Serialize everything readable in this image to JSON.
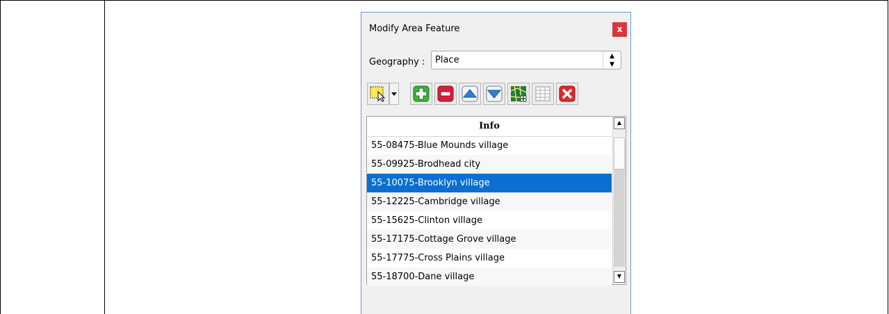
{
  "dialog": {
    "title": "Modify Area Feature",
    "close_label": "x",
    "geography_label": "Geography :",
    "geography_value": "Place"
  },
  "toolbar": {
    "icons": [
      "select-feature-icon",
      "dropdown-arrow-icon",
      "add-icon",
      "remove-icon",
      "move-up-icon",
      "move-down-icon",
      "map-view-icon",
      "table-view-icon",
      "delete-icon"
    ]
  },
  "list": {
    "header": "Info",
    "items": [
      "55-08475-Blue Mounds village",
      "55-09925-Brodhead city",
      "55-10075-Brooklyn village",
      "55-12225-Cambridge village",
      "55-15625-Clinton village",
      "55-17175-Cottage Grove village",
      "55-17775-Cross Plains village",
      "55-18700-Dane village"
    ],
    "selected_index": 2
  }
}
